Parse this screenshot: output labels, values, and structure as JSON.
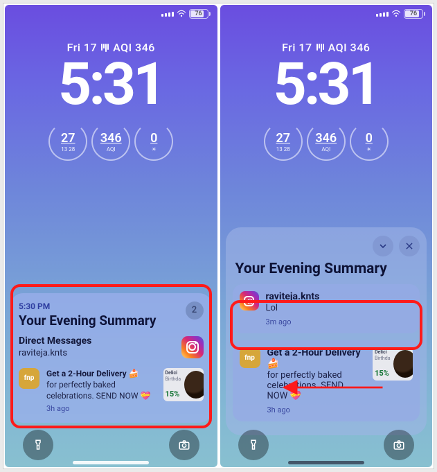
{
  "status": {
    "battery": "76"
  },
  "lock": {
    "date": "Fri 17",
    "aqi_label": "AQI 346",
    "time": "5:31",
    "w1_main": "27",
    "w1_sub": "13  28",
    "w2_main": "346",
    "w2_sub": "AQI",
    "w3_main": "0",
    "w3_sub": ""
  },
  "summary1": {
    "time": "5:30 PM",
    "title": "Your Evening Summary",
    "count": "2",
    "dm_heading": "Direct Messages",
    "dm_user": "raviteja.knts",
    "fnp_title": "Get a 2-Hour Delivery 🍰",
    "fnp_body": "for perfectly baked celebrations. SEND NOW 💝",
    "fnp_time": "3h ago",
    "promo_l1": "Delici",
    "promo_l2": "Birthda",
    "promo_pct": "15%"
  },
  "summary2": {
    "title": "Your Evening Summary",
    "msg_user": "raviteja.knts",
    "msg_text": "Lol",
    "msg_time": "3m ago",
    "fnp_title": "Get a 2-Hour Delivery 🍰",
    "fnp_body": "for perfectly baked celebrations. SEND NOW 💝",
    "fnp_time": "3h ago",
    "promo_l1": "Delici",
    "promo_l2": "Birthda",
    "promo_pct": "15%"
  },
  "icons": {
    "fnp": "fnp"
  }
}
